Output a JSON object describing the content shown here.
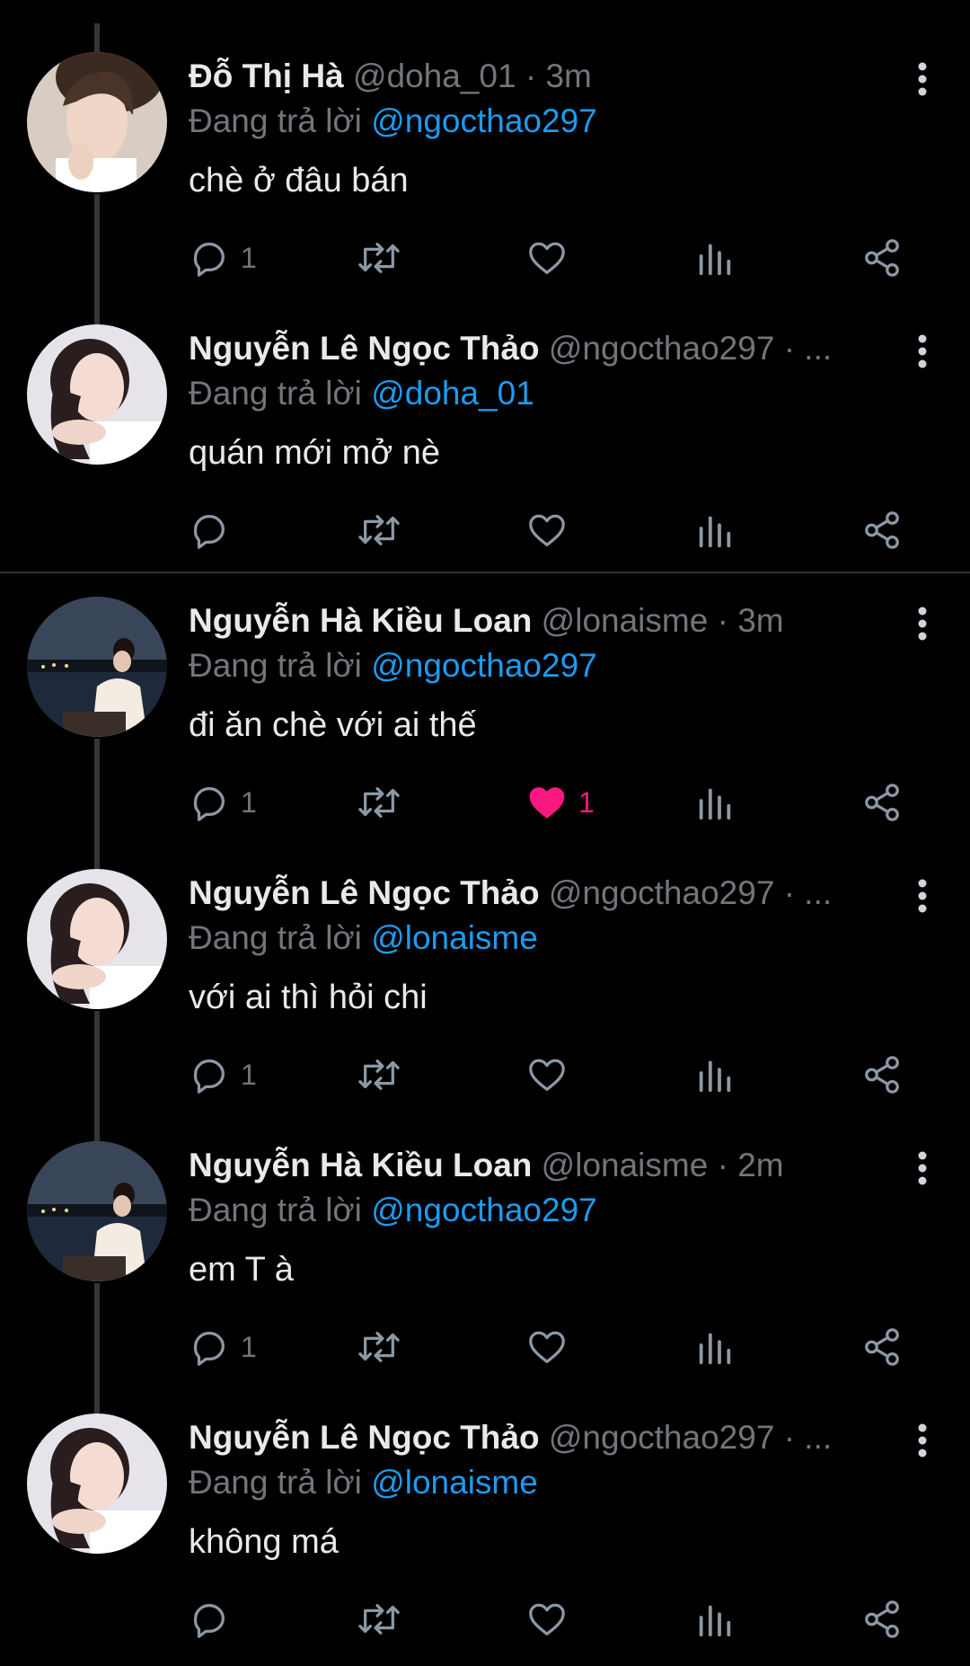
{
  "reply_prefix": "Đang trả lời",
  "colors": {
    "background": "#000000",
    "mention": "#1d9bf0",
    "muted": "#71767b",
    "like_active": "#f91880"
  },
  "tweets": [
    {
      "name": "Đỗ Thị Hà",
      "handle": "@doha_01",
      "sep": "·",
      "time": "3m",
      "replying_to": "@ngocthao297",
      "text": "chè ở đâu bán",
      "reply_count": "1",
      "like_count": "",
      "liked": false,
      "avatar": "avatar-do-thi-ha"
    },
    {
      "name": "Nguyễn Lê Ngọc Thảo",
      "handle": "@ngocthao297",
      "sep": "·",
      "time": "...",
      "replying_to": "@doha_01",
      "text": "quán mới mở nè",
      "reply_count": "",
      "like_count": "",
      "liked": false,
      "avatar": "avatar-ngoc-thao"
    },
    {
      "name": "Nguyễn Hà Kiều Loan",
      "handle": "@lonaisme",
      "sep": "·",
      "time": "3m",
      "replying_to": "@ngocthao297",
      "text": "đi ăn chè với ai thế",
      "reply_count": "1",
      "like_count": "1",
      "liked": true,
      "avatar": "avatar-kieu-loan"
    },
    {
      "name": "Nguyễn Lê Ngọc Thảo",
      "handle": "@ngocthao297",
      "sep": "·",
      "time": "...",
      "replying_to": "@lonaisme",
      "text": "với ai thì hỏi chi",
      "reply_count": "1",
      "like_count": "",
      "liked": false,
      "avatar": "avatar-ngoc-thao"
    },
    {
      "name": "Nguyễn Hà Kiều Loan",
      "handle": "@lonaisme",
      "sep": "·",
      "time": "2m",
      "replying_to": "@ngocthao297",
      "text": "em T à",
      "reply_count": "1",
      "like_count": "",
      "liked": false,
      "avatar": "avatar-kieu-loan"
    },
    {
      "name": "Nguyễn Lê Ngọc Thảo",
      "handle": "@ngocthao297",
      "sep": "·",
      "time": "...",
      "replying_to": "@lonaisme",
      "text": "không má",
      "reply_count": "",
      "like_count": "",
      "liked": false,
      "avatar": "avatar-ngoc-thao"
    }
  ]
}
